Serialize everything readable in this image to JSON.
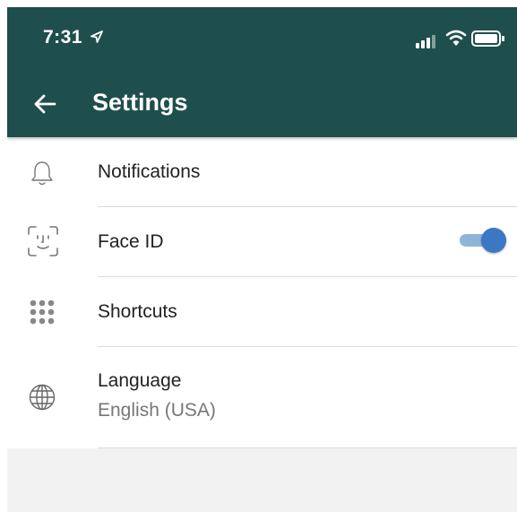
{
  "status_bar": {
    "time": "7:31",
    "icons": [
      "location-arrow-icon",
      "cellular-signal-icon",
      "wifi-icon",
      "battery-icon"
    ]
  },
  "app_bar": {
    "title": "Settings",
    "back_icon": "arrow-left-icon",
    "color": "#1f4f4c"
  },
  "settings": {
    "items": [
      {
        "label": "Notifications",
        "icon": "bell-icon"
      },
      {
        "label": "Face ID",
        "icon": "face-id-icon",
        "toggle_on": true
      },
      {
        "label": "Shortcuts",
        "icon": "grid-dots-icon"
      },
      {
        "label": "Language",
        "value": "English (USA)",
        "icon": "globe-icon"
      }
    ]
  },
  "colors": {
    "toggle_knob": "#3a78c4",
    "toggle_track": "#8fb4d8",
    "background": "#f2f2f2"
  }
}
